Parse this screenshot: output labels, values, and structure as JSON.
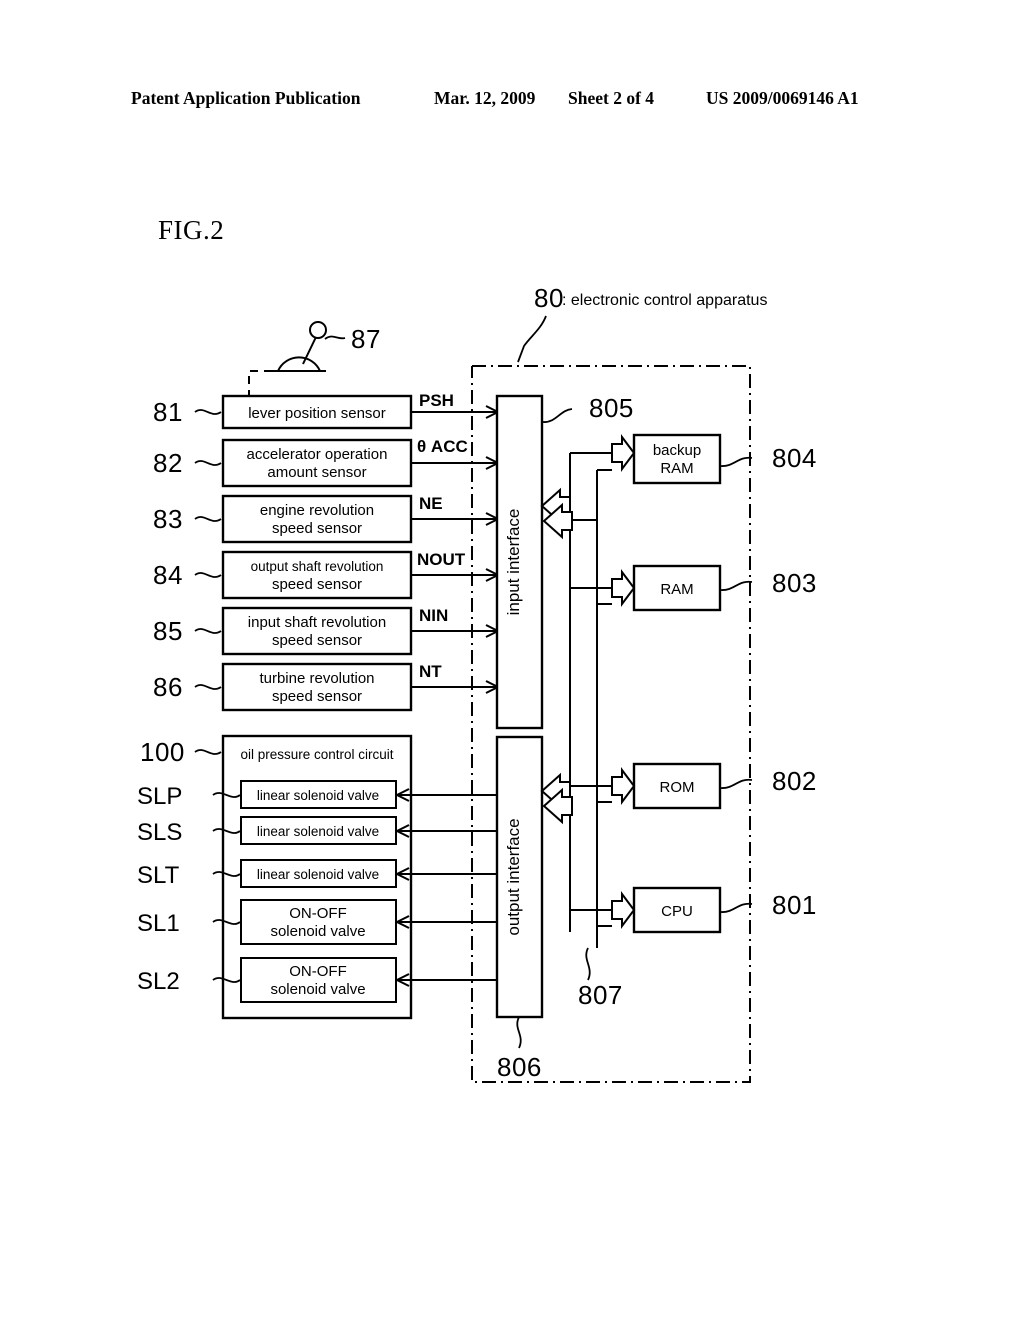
{
  "header": {
    "publication": "Patent Application Publication",
    "date": "Mar. 12, 2009",
    "sheet": "Sheet 2 of 4",
    "number": "US 2009/0069146 A1"
  },
  "figure": {
    "label": "FIG.2",
    "system_ref": "80",
    "system_caption": ": electronic control apparatus",
    "shift_lever_ref": "87"
  },
  "sensors": [
    {
      "ref": "81",
      "label_line1": "lever position sensor",
      "label_line2": "",
      "signal": "PSH"
    },
    {
      "ref": "82",
      "label_line1": "accelerator operation",
      "label_line2": "amount sensor",
      "signal": "θ ACC"
    },
    {
      "ref": "83",
      "label_line1": "engine revolution",
      "label_line2": "speed sensor",
      "signal": "NE"
    },
    {
      "ref": "84",
      "label_line1": "output shaft revolution",
      "label_line2": "speed sensor",
      "signal": "NOUT"
    },
    {
      "ref": "85",
      "label_line1": "input shaft revolution",
      "label_line2": "speed sensor",
      "signal": "NIN"
    },
    {
      "ref": "86",
      "label_line1": "turbine revolution",
      "label_line2": "speed sensor",
      "signal": "NT"
    }
  ],
  "oil_circuit": {
    "ref": "100",
    "title": "oil pressure control circuit",
    "valves": [
      {
        "ref": "SLP",
        "label_line1": "linear solenoid valve",
        "label_line2": ""
      },
      {
        "ref": "SLS",
        "label_line1": "linear solenoid valve",
        "label_line2": ""
      },
      {
        "ref": "SLT",
        "label_line1": "linear solenoid valve",
        "label_line2": ""
      },
      {
        "ref": "SL1",
        "label_line1": "ON-OFF",
        "label_line2": "solenoid valve"
      },
      {
        "ref": "SL2",
        "label_line1": "ON-OFF",
        "label_line2": "solenoid valve"
      }
    ]
  },
  "interfaces": {
    "input": {
      "label": "input interface",
      "ref": "805"
    },
    "output": {
      "label": "output interface",
      "ref": "806"
    },
    "bus_ref": "807"
  },
  "memory_blocks": [
    {
      "label_line1": "backup",
      "label_line2": "RAM",
      "ref": "804"
    },
    {
      "label_line1": "RAM",
      "label_line2": "",
      "ref": "803"
    },
    {
      "label_line1": "ROM",
      "label_line2": "",
      "ref": "802"
    },
    {
      "label_line1": "CPU",
      "label_line2": "",
      "ref": "801"
    }
  ],
  "colors": {
    "ink": "#000000",
    "paper": "#ffffff"
  }
}
